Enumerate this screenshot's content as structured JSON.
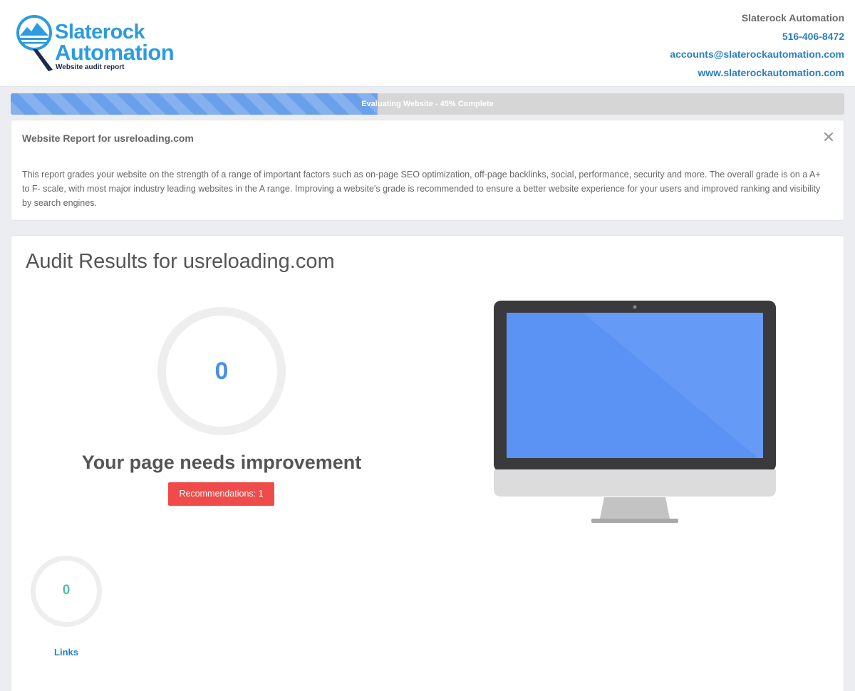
{
  "header": {
    "logo": {
      "line1": "Slaterock",
      "line2": "Automation",
      "tagline": "Website audit report"
    },
    "contact": {
      "company": "Slaterock Automation",
      "phone": "516-406-8472",
      "email": "accounts@slaterockautomation.com",
      "website": "www.slaterockautomation.com"
    }
  },
  "progress": {
    "percent": 45,
    "label": "Evaluating Website - 45% Complete",
    "fill_color": "#6aa0ea"
  },
  "intro": {
    "title": "Website Report for usreloading.com",
    "close_icon": "close-icon",
    "description": "This report grades your website on the strength of a range of important factors such as on-page SEO optimization, off-page backlinks, social, performance, security and more. The overall grade is on a A+ to F- scale, with most major industry leading websites in the A range. Improving a website's grade is recommended to ensure a better website experience for your users and improved ranking and visibility by search engines."
  },
  "results": {
    "title": "Audit Results for usreloading.com",
    "score": "0",
    "verdict": "Your page needs improvement",
    "recommendations_label": "Recommendations: 1",
    "recommendations_color": "#ef4b4b",
    "links": {
      "value": "0",
      "label": "Links"
    }
  }
}
